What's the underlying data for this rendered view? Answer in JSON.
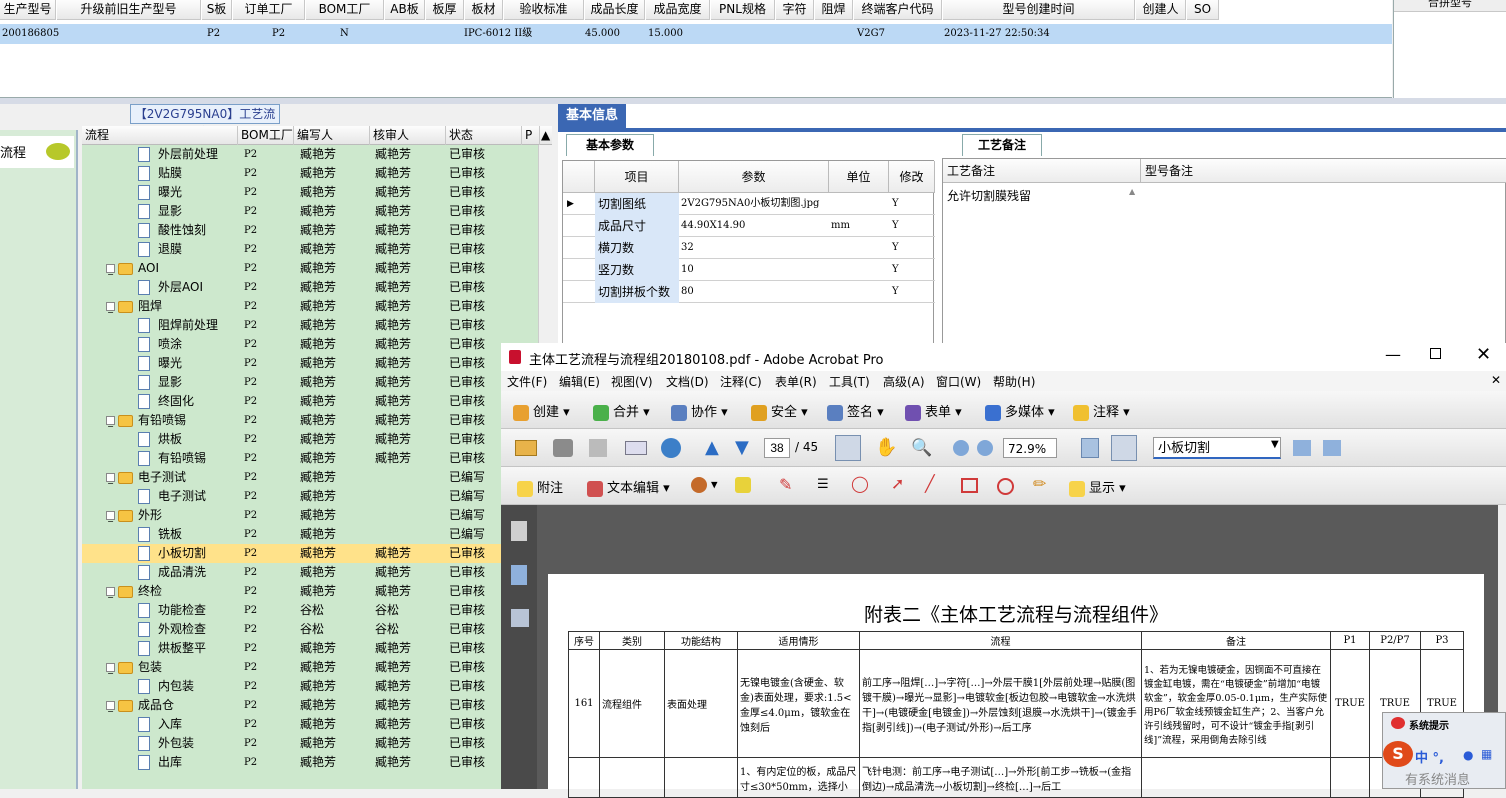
{
  "top_grid": {
    "columns": [
      "生产型号",
      "升级前旧生产型号",
      "S板",
      "订单工厂",
      "BOM工厂",
      "AB板",
      "板厚",
      "板材",
      "验收标准",
      "成品长度",
      "成品宽度",
      "PNL规格",
      "字符",
      "阻焊",
      "终端客户代码",
      "型号创建时间",
      "创建人",
      "SO"
    ],
    "row": {
      "prod_no": "200186805",
      "s_board": "P2",
      "order_factory": "P2",
      "bom_factory": "N",
      "standard": "IPC-6012 II级",
      "length": "45.000",
      "width": "15.000",
      "terminal_code": "V2G7",
      "created": "2023-11-27 22:50:34"
    },
    "right_header": "合拼型号"
  },
  "left_panel": {
    "title": "【2V2G795NA0】工艺流程",
    "sidebar_label": "流程",
    "tree_headers": [
      "流程",
      "BOM工厂",
      "编写人",
      "核审人",
      "状态",
      "P"
    ],
    "rows": [
      {
        "name": "外层前处理",
        "bom": "P2",
        "writer": "臧艳芳",
        "reviewer": "臧艳芳",
        "status": "已审核",
        "type": "doc"
      },
      {
        "name": "贴膜",
        "bom": "P2",
        "writer": "臧艳芳",
        "reviewer": "臧艳芳",
        "status": "已审核",
        "type": "doc"
      },
      {
        "name": "曝光",
        "bom": "P2",
        "writer": "臧艳芳",
        "reviewer": "臧艳芳",
        "status": "已审核",
        "type": "doc"
      },
      {
        "name": "显影",
        "bom": "P2",
        "writer": "臧艳芳",
        "reviewer": "臧艳芳",
        "status": "已审核",
        "type": "doc"
      },
      {
        "name": "酸性蚀刻",
        "bom": "P2",
        "writer": "臧艳芳",
        "reviewer": "臧艳芳",
        "status": "已审核",
        "type": "doc"
      },
      {
        "name": "退膜",
        "bom": "P2",
        "writer": "臧艳芳",
        "reviewer": "臧艳芳",
        "status": "已审核",
        "type": "doc"
      },
      {
        "name": "AOI",
        "bom": "P2",
        "writer": "臧艳芳",
        "reviewer": "臧艳芳",
        "status": "已审核",
        "type": "folder"
      },
      {
        "name": "外层AOI",
        "bom": "P2",
        "writer": "臧艳芳",
        "reviewer": "臧艳芳",
        "status": "已审核",
        "type": "doc"
      },
      {
        "name": "阻焊",
        "bom": "P2",
        "writer": "臧艳芳",
        "reviewer": "臧艳芳",
        "status": "已审核",
        "type": "folder"
      },
      {
        "name": "阻焊前处理",
        "bom": "P2",
        "writer": "臧艳芳",
        "reviewer": "臧艳芳",
        "status": "已审核",
        "type": "doc"
      },
      {
        "name": "喷涂",
        "bom": "P2",
        "writer": "臧艳芳",
        "reviewer": "臧艳芳",
        "status": "已审核",
        "type": "doc"
      },
      {
        "name": "曝光",
        "bom": "P2",
        "writer": "臧艳芳",
        "reviewer": "臧艳芳",
        "status": "已审核",
        "type": "doc"
      },
      {
        "name": "显影",
        "bom": "P2",
        "writer": "臧艳芳",
        "reviewer": "臧艳芳",
        "status": "已审核",
        "type": "doc"
      },
      {
        "name": "终固化",
        "bom": "P2",
        "writer": "臧艳芳",
        "reviewer": "臧艳芳",
        "status": "已审核",
        "type": "doc"
      },
      {
        "name": "有铅喷锡",
        "bom": "P2",
        "writer": "臧艳芳",
        "reviewer": "臧艳芳",
        "status": "已审核",
        "type": "folder"
      },
      {
        "name": "烘板",
        "bom": "P2",
        "writer": "臧艳芳",
        "reviewer": "臧艳芳",
        "status": "已审核",
        "type": "doc"
      },
      {
        "name": "有铅喷锡",
        "bom": "P2",
        "writer": "臧艳芳",
        "reviewer": "臧艳芳",
        "status": "已审核",
        "type": "doc"
      },
      {
        "name": "电子测试",
        "bom": "P2",
        "writer": "臧艳芳",
        "reviewer": "",
        "status": "已编写",
        "type": "folder"
      },
      {
        "name": "电子测试",
        "bom": "P2",
        "writer": "臧艳芳",
        "reviewer": "",
        "status": "已编写",
        "type": "doc"
      },
      {
        "name": "外形",
        "bom": "P2",
        "writer": "臧艳芳",
        "reviewer": "",
        "status": "已编写",
        "type": "folder"
      },
      {
        "name": "铣板",
        "bom": "P2",
        "writer": "臧艳芳",
        "reviewer": "",
        "status": "已编写",
        "type": "doc"
      },
      {
        "name": "小板切割",
        "bom": "P2",
        "writer": "臧艳芳",
        "reviewer": "臧艳芳",
        "status": "已审核",
        "type": "doc",
        "selected": true
      },
      {
        "name": "成品清洗",
        "bom": "P2",
        "writer": "臧艳芳",
        "reviewer": "臧艳芳",
        "status": "已审核",
        "type": "doc"
      },
      {
        "name": "终检",
        "bom": "P2",
        "writer": "臧艳芳",
        "reviewer": "臧艳芳",
        "status": "已审核",
        "type": "folder"
      },
      {
        "name": "功能检查",
        "bom": "P2",
        "writer": "谷松",
        "reviewer": "谷松",
        "status": "已审核",
        "type": "doc"
      },
      {
        "name": "外观检查",
        "bom": "P2",
        "writer": "谷松",
        "reviewer": "谷松",
        "status": "已审核",
        "type": "doc"
      },
      {
        "name": "烘板整平",
        "bom": "P2",
        "writer": "臧艳芳",
        "reviewer": "臧艳芳",
        "status": "已审核",
        "type": "doc"
      },
      {
        "name": "包装",
        "bom": "P2",
        "writer": "臧艳芳",
        "reviewer": "臧艳芳",
        "status": "已审核",
        "type": "folder"
      },
      {
        "name": "内包装",
        "bom": "P2",
        "writer": "臧艳芳",
        "reviewer": "臧艳芳",
        "status": "已审核",
        "type": "doc"
      },
      {
        "name": "成品仓",
        "bom": "P2",
        "writer": "臧艳芳",
        "reviewer": "臧艳芳",
        "status": "已审核",
        "type": "folder"
      },
      {
        "name": "入库",
        "bom": "P2",
        "writer": "臧艳芳",
        "reviewer": "臧艳芳",
        "status": "已审核",
        "type": "doc"
      },
      {
        "name": "外包装",
        "bom": "P2",
        "writer": "臧艳芳",
        "reviewer": "臧艳芳",
        "status": "已审核",
        "type": "doc"
      },
      {
        "name": "出库",
        "bom": "P2",
        "writer": "臧艳芳",
        "reviewer": "臧艳芳",
        "status": "已审核",
        "type": "doc"
      }
    ]
  },
  "right_panel": {
    "title": "基本信息",
    "tab_params": "基本参数",
    "tab_notes": "工艺备注",
    "param_headers": [
      "项目",
      "参数",
      "单位",
      "修改"
    ],
    "params": [
      {
        "k": "切割图纸",
        "v": "2V2G795NA0小板切割图.jpg",
        "u": "",
        "m": "Y"
      },
      {
        "k": "成品尺寸",
        "v": "44.90X14.90",
        "u": "mm",
        "m": "Y"
      },
      {
        "k": "横刀数",
        "v": "32",
        "u": "",
        "m": "Y"
      },
      {
        "k": "竖刀数",
        "v": "10",
        "u": "",
        "m": "Y"
      },
      {
        "k": "切割拼板个数",
        "v": "80",
        "u": "",
        "m": "Y"
      }
    ],
    "notes_headers": [
      "工艺备注",
      "型号备注"
    ],
    "note_text": "允许切割膜残留"
  },
  "acrobat": {
    "title": "主体工艺流程与流程组20180108.pdf - Adobe Acrobat Pro",
    "menu": [
      "文件(F)",
      "编辑(E)",
      "视图(V)",
      "文档(D)",
      "注释(C)",
      "表单(R)",
      "工具(T)",
      "高级(A)",
      "窗口(W)",
      "帮助(H)"
    ],
    "toolbar1": [
      "创建",
      "合并",
      "协作",
      "安全",
      "签名",
      "表单",
      "多媒体",
      "注释"
    ],
    "page_current": "38",
    "page_total": "/ 45",
    "zoom": "72.9%",
    "search_value": "小板切割",
    "toolbar3": {
      "attach": "附注",
      "text_edit": "文本编辑",
      "show": "显示"
    },
    "doc_title": "附表二《主体工艺流程与流程组件》",
    "doc_headers": [
      "序号",
      "类别",
      "功能结构",
      "适用情形",
      "流程",
      "备注",
      "P1",
      "P2/P7",
      "P3"
    ],
    "doc_row": {
      "no": "161",
      "cat": "流程组件",
      "func": "表面处理",
      "case": "无镍电镀金(含硬金、软金)表面处理，要求:1.5<金厚≤4.0μm，镀软金在蚀刻后",
      "flow": "前工序→阻焊[…]→字符[…]→外层干膜1[外层前处理→贴膜(图镀干膜)→曝光→显影]→电镀软金[板边包胶→电镀软金→水洗烘干]→(电镀硬金[电镀金])→外层蚀刻[退膜→水洗烘干]→(镀金手指[剥引线])→(电子测试/外形)→后工序",
      "note": "1、若为无镍电镀硬金，因铜面不可直接在镀金缸电镀，需在“电镀硬金”前增加“电镀软金”，软金金厚0.05-0.1μm，生产实际使用P6厂软金线预镀金缸生产；2、当客户允许引线残留时，可不设计“镀金手指[剥引线]”流程，采用倒角去除引线",
      "p1": "TRUE",
      "p2": "TRUE",
      "p3": "TRUE"
    },
    "doc_row2": {
      "case": "1、有内定位的板，成品尺寸≤30*50mm，选择小",
      "flow": "飞针电测：前工序→电子测试[…]→外形[前工步→铣板→(金指倒边)→成品清洗→小板切割]→终检[…]→后工"
    }
  },
  "system_tip": {
    "title": "系统提示",
    "ime": "中 °,",
    "text": "有系统消息"
  }
}
